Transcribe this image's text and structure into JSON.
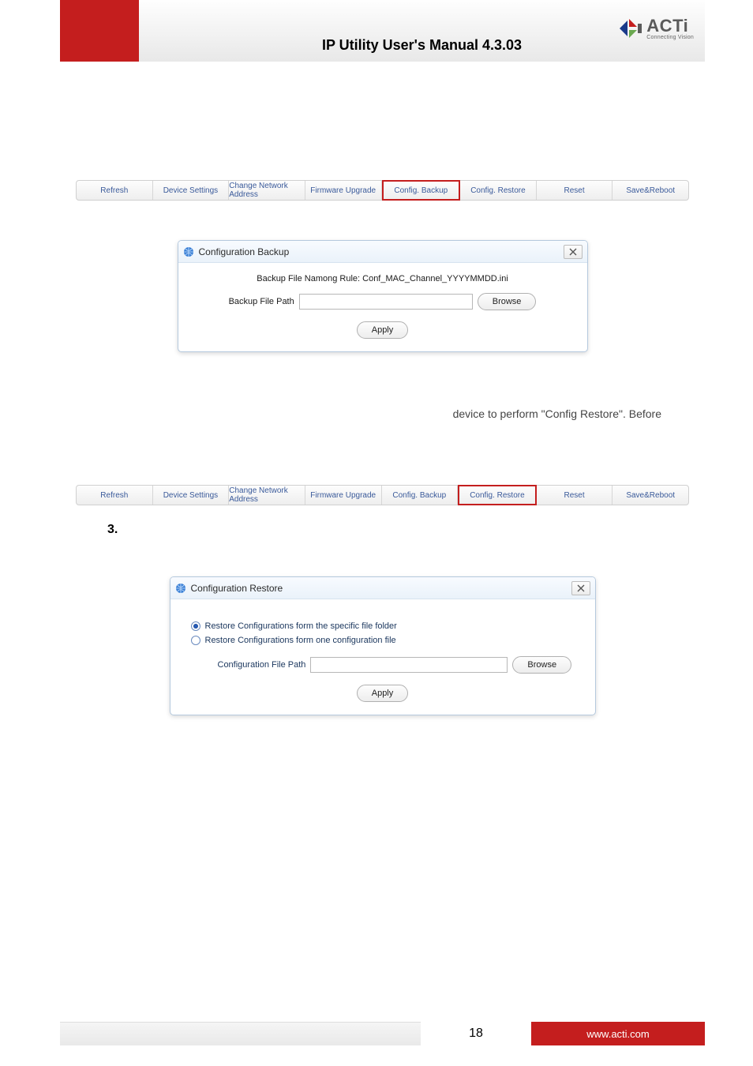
{
  "header": {
    "title": "IP Utility User's Manual 4.3.03",
    "logo_main": "ACTi",
    "logo_sub": "Connecting Vision"
  },
  "section1": {
    "quote_open": "“",
    "quote_close": "”"
  },
  "toolbar": {
    "refresh": "Refresh",
    "device_settings": "Device Settings",
    "change_network": "Change Network Address",
    "firmware": "Firmware Upgrade",
    "config_backup": "Config. Backup",
    "config_restore": "Config. Restore",
    "reset": "Reset",
    "save_reboot": "Save&Reboot"
  },
  "dialog_backup": {
    "title": "Configuration Backup",
    "rule_text": "Backup File Namong Rule:  Conf_MAC_Channel_YYYYMMDD.ini",
    "path_label": "Backup File Path",
    "browse": "Browse",
    "apply": "Apply"
  },
  "section2": {
    "line": "device to perform \"Config Restore\". Before",
    "quote_open": "“",
    "quote_mid": "”",
    "quote_close": "”"
  },
  "step3": {
    "num": "3.",
    "apostrophe": "’"
  },
  "dialog_restore": {
    "title": "Configuration Restore",
    "radio1": "Restore Configurations form the specific file folder",
    "radio2": "Restore Configurations form one configuration file",
    "path_label": "Configuration File Path",
    "browse": "Browse",
    "apply": "Apply"
  },
  "footer": {
    "page": "18",
    "url": "www.acti.com"
  }
}
